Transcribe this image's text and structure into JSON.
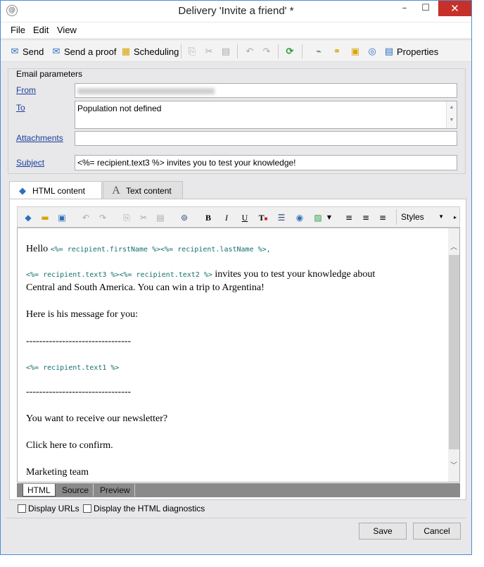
{
  "window": {
    "title": "Delivery 'Invite a friend' *",
    "minimize_glyph": "–",
    "maximize_glyph": "☐",
    "close_glyph": "✕"
  },
  "menu": [
    "File",
    "Edit",
    "View"
  ],
  "toolbar": {
    "send": "Send",
    "send_proof": "Send a proof",
    "scheduling": "Scheduling",
    "properties": "Properties"
  },
  "params": {
    "group_label": "Email parameters",
    "from_label": "From",
    "from_value": "",
    "to_label": "To",
    "to_value": "Population not defined",
    "attachments_label": "Attachments",
    "attachments_value": "",
    "subject_label": "Subject",
    "subject_value": "<%= recipient.text3 %> invites you to test your knowledge!"
  },
  "tabs": {
    "html": "HTML content",
    "text": "Text content"
  },
  "editor_toolbar": {
    "bold": "B",
    "italic": "I",
    "underline": "U",
    "styles": "Styles"
  },
  "content": {
    "hello": "Hello",
    "hello_code": "<%= recipient.firstName %><%= recipient.lastName %>,",
    "line2_code": "<%= recipient.text3 %><%= recipient.text2 %>",
    "line2_text": " invites you to test your knowledge about",
    "line3": "Central and South America. You can win a trip to Argentina!",
    "line4": "Here is his message for you:",
    "dashes1": "--------------------------------",
    "text1_code": "<%= recipient.text1 %>",
    "dashes2": "--------------------------------",
    "newsletter": "You want to receive our newsletter?",
    "confirm": "Click here to confirm.",
    "signature": "Marketing team"
  },
  "view_tabs": [
    "HTML",
    "Source",
    "Preview"
  ],
  "options": {
    "display_urls": "Display URLs",
    "display_diag": "Display the HTML diagnostics"
  },
  "buttons": {
    "save": "Save",
    "cancel": "Cancel"
  },
  "colors": {
    "link": "#1a3e9c",
    "code": "#167070",
    "close": "#c7302a",
    "accent_green": "#2e9c3e"
  }
}
